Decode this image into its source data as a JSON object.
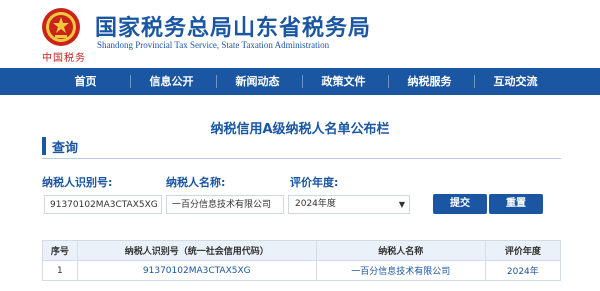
{
  "header": {
    "emblem_caption": "中国税务",
    "title": "国家税务总局山东省税务局",
    "subtitle": "Shandong Provincial Tax Service, State Taxation Administration"
  },
  "nav": {
    "items": [
      "首页",
      "信息公开",
      "新闻动态",
      "政策文件",
      "纳税服务",
      "互动交流"
    ]
  },
  "page_title": "纳税信用A级纳税人名单公布栏",
  "section": {
    "title": "查询"
  },
  "form": {
    "id_label": "纳税人识别号:",
    "id_value": "91370102MA3CTAX5XG",
    "name_label": "纳税人名称:",
    "name_value": "一百分信息技术有限公司",
    "year_label": "评价年度:",
    "year_value": "2024年度",
    "submit_label": "提交",
    "reset_label": "重置"
  },
  "table": {
    "headers": [
      "序号",
      "纳税人识别号（统一社会信用代码）",
      "纳税人名称",
      "评价年度"
    ],
    "rows": [
      [
        "1",
        "91370102MA3CTAX5XG",
        "一百分信息技术有限公司",
        "2024年"
      ]
    ]
  },
  "colors": {
    "brand_blue": "#1b56a3",
    "emblem_red": "#c8241c"
  }
}
